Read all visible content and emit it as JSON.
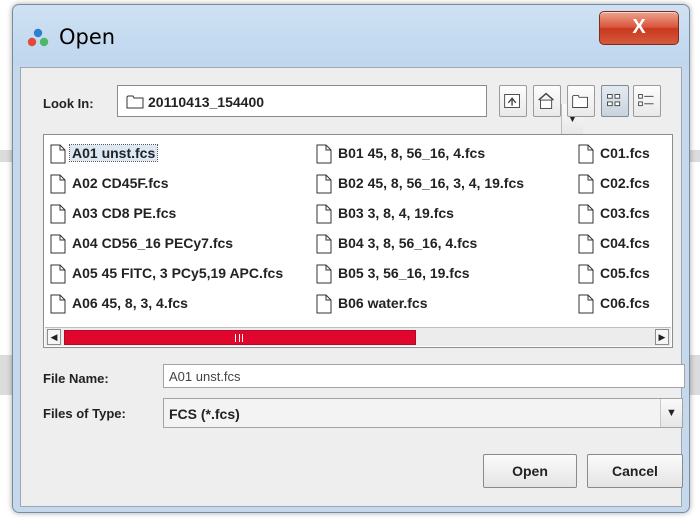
{
  "window": {
    "title": "Open",
    "close_glyph": "X"
  },
  "lookin": {
    "label": "Look In:",
    "value": "20110413_154400"
  },
  "toolbar": {
    "icons": [
      "up-folder-icon",
      "home-icon",
      "new-folder-icon",
      "list-view-icon",
      "details-view-icon"
    ],
    "active": "list-view-icon"
  },
  "files": {
    "columns": [
      [
        "A01 unst.fcs",
        "A02 CD45F.fcs",
        "A03 CD8 PE.fcs",
        "A04 CD56_16 PECy7.fcs",
        "A05 45 FITC, 3 PCy5,19 APC.fcs",
        "A06 45, 8, 3, 4.fcs"
      ],
      [
        "B01 45, 8, 56_16, 4.fcs",
        "B02 45, 8, 56_16, 3, 4, 19.fcs",
        "B03 3, 8, 4, 19.fcs",
        "B04 3, 8, 56_16, 4.fcs",
        "B05 3, 56_16, 19.fcs",
        "B06 water.fcs"
      ],
      [
        "C01.fcs",
        "C02.fcs",
        "C03.fcs",
        "C04.fcs",
        "C05.fcs",
        "C06.fcs"
      ]
    ],
    "selected": "A01 unst.fcs"
  },
  "scrollbar": {
    "thumb_color": "#e1062e"
  },
  "filename": {
    "label": "File Name:",
    "value": "A01 unst.fcs"
  },
  "filetype": {
    "label": "Files of Type:",
    "value": "FCS (*.fcs)"
  },
  "buttons": {
    "open": "Open",
    "cancel": "Cancel"
  }
}
